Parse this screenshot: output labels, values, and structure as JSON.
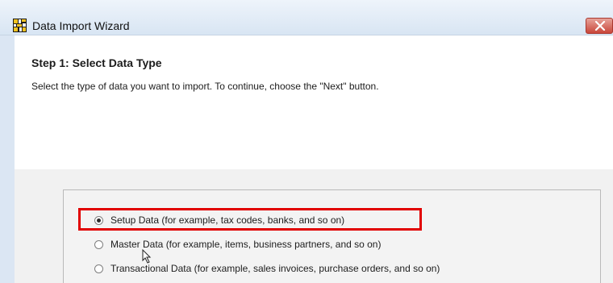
{
  "window": {
    "title": "Data Import Wizard",
    "colors": {
      "titlebar": "#dfe9f5",
      "close_button": "#c9463a",
      "content_background": "#ffffff",
      "lower_background": "#f1f1f1",
      "highlight": "#e10000"
    },
    "icons": {
      "app": "data-import-wizard-icon",
      "close": "close-icon",
      "cursor": "mouse-pointer-icon"
    }
  },
  "header": {
    "step_title": "Step 1: Select Data Type",
    "description": "Select the type of data you want to import. To continue, choose the \"Next\" button."
  },
  "options": [
    {
      "label": "Setup Data (for example, tax codes, banks, and so on)",
      "selected": true
    },
    {
      "label": "Master Data (for example, items, business partners, and so on)",
      "selected": false
    },
    {
      "label": "Transactional Data (for example, sales invoices, purchase orders, and so on)",
      "selected": false
    }
  ]
}
